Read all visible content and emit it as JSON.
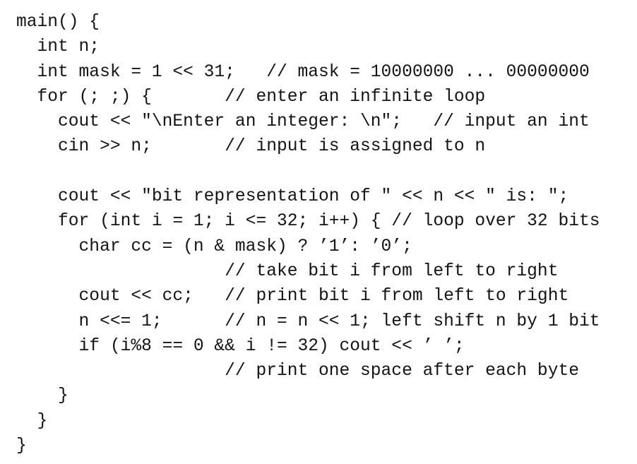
{
  "document": {
    "type": "code-listing",
    "language": "C++",
    "lines": [
      "main() {",
      "  int n;",
      "  int mask = 1 << 31;   // mask = 10000000 ... 00000000",
      "  for (; ;) {       // enter an infinite loop",
      "    cout << \"\\nEnter an integer: \\n\";   // input an int",
      "    cin >> n;       // input is assigned to n",
      "",
      "    cout << \"bit representation of \" << n << \" is: \";",
      "    for (int i = 1; i <= 32; i++) { // loop over 32 bits",
      "      char cc = (n & mask) ? ’1’: ’0’;",
      "                    // take bit i from left to right",
      "      cout << cc;   // print bit i from left to right",
      "      n <<= 1;      // n = n << 1; left shift n by 1 bit",
      "      if (i%8 == 0 && i != 32) cout << ’ ’;",
      "                    // print one space after each byte",
      "    }",
      "  }",
      "}"
    ]
  }
}
